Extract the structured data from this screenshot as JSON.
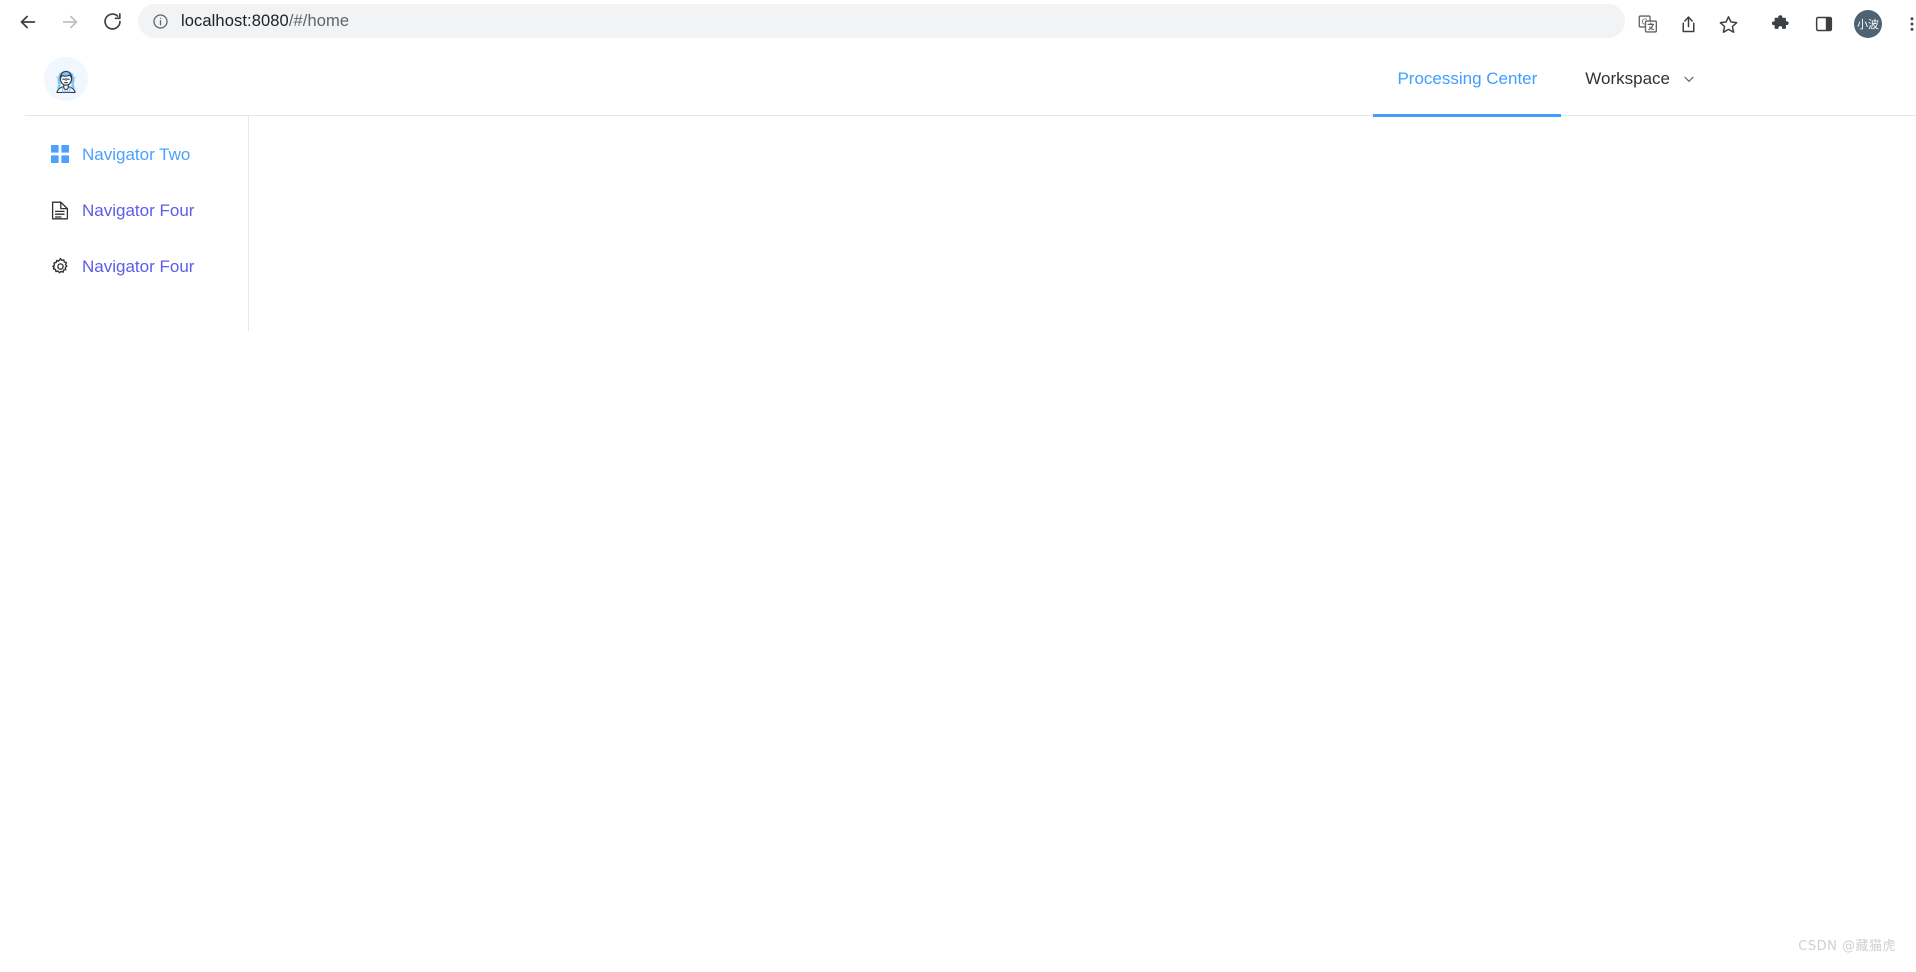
{
  "browser": {
    "back_label": "Back",
    "forward_label": "Forward",
    "reload_label": "Reload",
    "url_main": "localhost:8080",
    "url_path": "/#/home",
    "site_info_icon": "info-circle-icon",
    "translate_icon": "google-translate-icon",
    "share_icon": "share-icon",
    "bookmark_icon": "star-icon",
    "extensions_icon": "puzzle-piece-icon",
    "side_panel_icon": "side-panel-icon",
    "profile_initials": "小波",
    "menu_icon": "three-dot-menu-icon"
  },
  "header": {
    "logo_alt": "user-avatar-logo",
    "tabs": [
      {
        "label": "Processing Center",
        "active": true
      },
      {
        "label": "Workspace",
        "active": false,
        "has_chevron": true
      }
    ]
  },
  "sidebar": {
    "items": [
      {
        "label": "Navigator Two",
        "icon": "grid-icon",
        "color": "#4ba1fb"
      },
      {
        "label": "Navigator Four",
        "icon": "document-icon",
        "color": "#5c5ce8"
      },
      {
        "label": "Navigator Four",
        "icon": "gear-icon",
        "color": "#5c5ce8"
      }
    ]
  },
  "footer": {
    "watermark": "CSDN @藏猫虎"
  },
  "colors": {
    "accent": "#409eff",
    "sidebar_active": "#4ba1fb",
    "sidebar_link": "#5c5ce8",
    "border": "#e4e7ed"
  }
}
